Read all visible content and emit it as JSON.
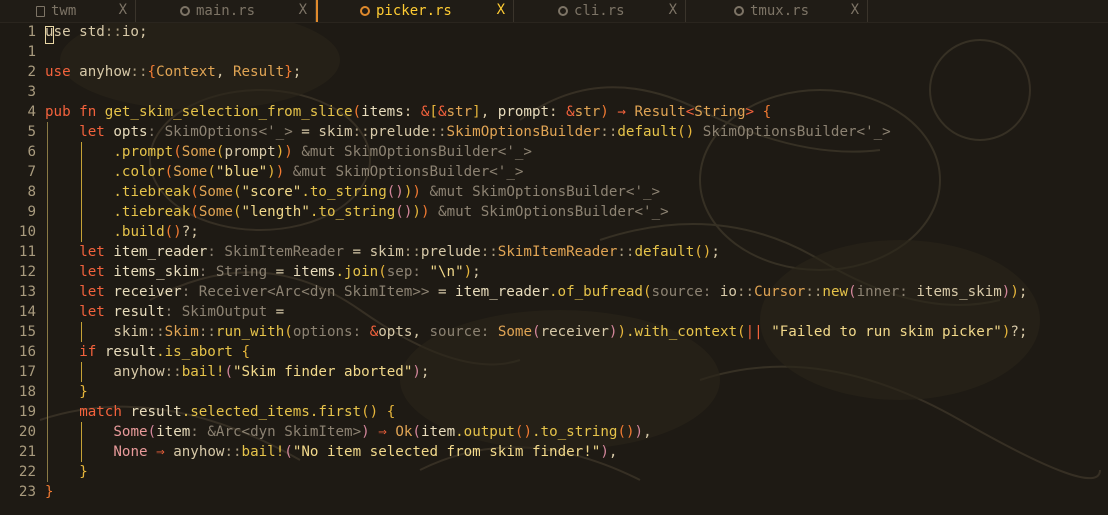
{
  "tabs": [
    {
      "label": "twm",
      "icon": "file-icon",
      "close": "X",
      "active": false
    },
    {
      "label": "main.rs",
      "icon": "rust-icon",
      "close": "X",
      "active": false
    },
    {
      "label": "picker.rs",
      "icon": "rust-icon",
      "close": "X",
      "active": true
    },
    {
      "label": "cli.rs",
      "icon": "rust-icon",
      "close": "X",
      "active": false
    },
    {
      "label": "tmux.rs",
      "icon": "rust-icon",
      "close": "X",
      "active": false
    }
  ],
  "colors": {
    "background": "#1e1a14",
    "keyword": "#f3623c",
    "function": "#e6c34a",
    "string": "#f2d98b",
    "inlay_hint": "#8c8272",
    "active_tab": "#ffcc33",
    "indent_guide": "#c6a236"
  },
  "lines": [
    {
      "num": "1",
      "indent": 0,
      "segs": [
        [
          "pl",
          "use std"
        ],
        [
          "op",
          "::"
        ],
        [
          "pl",
          "io;"
        ]
      ]
    },
    {
      "num": "1",
      "indent": 0,
      "segs": []
    },
    {
      "num": "2",
      "indent": 0,
      "segs": [
        [
          "kw",
          "use "
        ],
        [
          "pl",
          "anyhow"
        ],
        [
          "op",
          "::"
        ],
        [
          "br",
          "{"
        ],
        [
          "ty2",
          "Context"
        ],
        [
          "pl",
          ", "
        ],
        [
          "ty2",
          "Result"
        ],
        [
          "br",
          "}"
        ],
        [
          "pl",
          ";"
        ]
      ]
    },
    {
      "num": "3",
      "indent": 0,
      "segs": []
    },
    {
      "num": "4",
      "indent": 0,
      "segs": [
        [
          "kw",
          "pub fn "
        ],
        [
          "fn",
          "get_skim_selection_from_slice"
        ],
        [
          "br",
          "("
        ],
        [
          "var",
          "items"
        ],
        [
          "pl",
          ": "
        ],
        [
          "kw",
          "&"
        ],
        [
          "br2",
          "["
        ],
        [
          "kw",
          "&"
        ],
        [
          "ty2",
          "str"
        ],
        [
          "br2",
          "]"
        ],
        [
          "pl",
          ", "
        ],
        [
          "var",
          "prompt"
        ],
        [
          "pl",
          ": "
        ],
        [
          "kw",
          "&"
        ],
        [
          "ty2",
          "str"
        ],
        [
          "br",
          ")"
        ],
        [
          "pl",
          " "
        ],
        [
          "kw",
          "→"
        ],
        [
          "pl",
          " "
        ],
        [
          "ty2",
          "Result"
        ],
        [
          "kw",
          "<"
        ],
        [
          "ty2",
          "String"
        ],
        [
          "kw",
          "> "
        ],
        [
          "br",
          "{"
        ]
      ]
    },
    {
      "num": "5",
      "indent": 1,
      "segs": [
        [
          "kw",
          "let "
        ],
        [
          "var",
          "opts"
        ],
        [
          "hint",
          ": SkimOptions<'_>"
        ],
        [
          "pl",
          " = "
        ],
        [
          "pl",
          "skim"
        ],
        [
          "op",
          "::"
        ],
        [
          "pl",
          "prelude"
        ],
        [
          "op",
          "::"
        ],
        [
          "ty2",
          "SkimOptionsBuilder"
        ],
        [
          "op",
          "::"
        ],
        [
          "fn",
          "default"
        ],
        [
          "br2",
          "()"
        ],
        [
          "hint",
          " SkimOptionsBuilder<'_>"
        ]
      ]
    },
    {
      "num": "6",
      "indent": 2,
      "segs": [
        [
          "fn",
          ".prompt"
        ],
        [
          "br",
          "("
        ],
        [
          "ty2",
          "Some"
        ],
        [
          "br2",
          "("
        ],
        [
          "pl",
          "prompt"
        ],
        [
          "br2",
          ")"
        ],
        [
          "br",
          ")"
        ],
        [
          "hint",
          " &mut SkimOptionsBuilder<'_>"
        ]
      ]
    },
    {
      "num": "7",
      "indent": 2,
      "segs": [
        [
          "fn",
          ".color"
        ],
        [
          "br",
          "("
        ],
        [
          "ty2",
          "Some"
        ],
        [
          "br2",
          "("
        ],
        [
          "str",
          "\"blue\""
        ],
        [
          "br2",
          ")"
        ],
        [
          "br",
          ")"
        ],
        [
          "hint",
          " &mut SkimOptionsBuilder<'_>"
        ]
      ]
    },
    {
      "num": "8",
      "indent": 2,
      "segs": [
        [
          "fn",
          ".tiebreak"
        ],
        [
          "br",
          "("
        ],
        [
          "ty2",
          "Some"
        ],
        [
          "br2",
          "("
        ],
        [
          "str",
          "\"score\""
        ],
        [
          "fn",
          ".to_string"
        ],
        [
          "br3",
          "()"
        ],
        [
          "br2",
          ")"
        ],
        [
          "br",
          ")"
        ],
        [
          "hint",
          " &mut SkimOptionsBuilder<'_>"
        ]
      ]
    },
    {
      "num": "9",
      "indent": 2,
      "segs": [
        [
          "fn",
          ".tiebreak"
        ],
        [
          "br",
          "("
        ],
        [
          "ty2",
          "Some"
        ],
        [
          "br2",
          "("
        ],
        [
          "str",
          "\"length\""
        ],
        [
          "fn",
          ".to_string"
        ],
        [
          "br3",
          "()"
        ],
        [
          "br2",
          ")"
        ],
        [
          "br",
          ")"
        ],
        [
          "hint",
          " &mut SkimOptionsBuilder<'_>"
        ]
      ]
    },
    {
      "num": "10",
      "indent": 2,
      "segs": [
        [
          "fn",
          ".build"
        ],
        [
          "br",
          "()"
        ],
        [
          "pl",
          "?;"
        ]
      ]
    },
    {
      "num": "11",
      "indent": 1,
      "segs": [
        [
          "kw",
          "let "
        ],
        [
          "var",
          "item_reader"
        ],
        [
          "hint",
          ": SkimItemReader"
        ],
        [
          "pl",
          " = skim"
        ],
        [
          "op",
          "::"
        ],
        [
          "pl",
          "prelude"
        ],
        [
          "op",
          "::"
        ],
        [
          "ty2",
          "SkimItemReader"
        ],
        [
          "op",
          "::"
        ],
        [
          "fn",
          "default"
        ],
        [
          "br2",
          "()"
        ],
        [
          "pl",
          ";"
        ]
      ]
    },
    {
      "num": "12",
      "indent": 1,
      "segs": [
        [
          "kw",
          "let "
        ],
        [
          "var",
          "items_skim"
        ],
        [
          "hint",
          ": String"
        ],
        [
          "pl",
          " = "
        ],
        [
          "var",
          "items"
        ],
        [
          "fn",
          ".join"
        ],
        [
          "br2",
          "("
        ],
        [
          "hint",
          "sep: "
        ],
        [
          "str",
          "\"\\n\""
        ],
        [
          "br2",
          ")"
        ],
        [
          "pl",
          ";"
        ]
      ]
    },
    {
      "num": "13",
      "indent": 1,
      "segs": [
        [
          "kw",
          "let "
        ],
        [
          "var",
          "receiver"
        ],
        [
          "hint",
          ": Receiver<Arc<dyn SkimItem>>"
        ],
        [
          "pl",
          " = "
        ],
        [
          "var",
          "item_reader"
        ],
        [
          "fn",
          ".of_bufread"
        ],
        [
          "br2",
          "("
        ],
        [
          "hint",
          "source: "
        ],
        [
          "pl",
          "io"
        ],
        [
          "op",
          "::"
        ],
        [
          "ty2",
          "Cursor"
        ],
        [
          "op",
          "::"
        ],
        [
          "fn",
          "new"
        ],
        [
          "br3",
          "("
        ],
        [
          "hint",
          "inner: "
        ],
        [
          "pl",
          "items_skim"
        ],
        [
          "br3",
          ")"
        ],
        [
          "br2",
          ")"
        ],
        [
          "pl",
          ";"
        ]
      ]
    },
    {
      "num": "14",
      "indent": 1,
      "segs": [
        [
          "kw",
          "let "
        ],
        [
          "var",
          "result"
        ],
        [
          "hint",
          ": SkimOutput"
        ],
        [
          "pl",
          " ="
        ]
      ]
    },
    {
      "num": "15",
      "indent": 2,
      "segs": [
        [
          "pl",
          "skim"
        ],
        [
          "op",
          "::"
        ],
        [
          "ty2",
          "Skim"
        ],
        [
          "op",
          "::"
        ],
        [
          "fn",
          "run_with"
        ],
        [
          "br2",
          "("
        ],
        [
          "hint",
          "options: "
        ],
        [
          "kw",
          "&"
        ],
        [
          "pl",
          "opts"
        ],
        [
          "pl",
          ", "
        ],
        [
          "hint",
          "source: "
        ],
        [
          "ty2",
          "Some"
        ],
        [
          "br3",
          "("
        ],
        [
          "pl",
          "receiver"
        ],
        [
          "br3",
          ")"
        ],
        [
          "br2",
          ")"
        ],
        [
          "fn",
          ".with_context"
        ],
        [
          "br2",
          "("
        ],
        [
          "kw",
          "|| "
        ],
        [
          "str",
          "\"Failed to run skim picker\""
        ],
        [
          "br2",
          ")"
        ],
        [
          "pl",
          "?;"
        ]
      ]
    },
    {
      "num": "16",
      "indent": 1,
      "segs": [
        [
          "kw",
          "if "
        ],
        [
          "var",
          "result"
        ],
        [
          "fn",
          ".is_abort"
        ],
        [
          "pl",
          " "
        ],
        [
          "br2",
          "{"
        ]
      ]
    },
    {
      "num": "17",
      "indent": 2,
      "segs": [
        [
          "pl",
          "anyhow"
        ],
        [
          "op",
          "::"
        ],
        [
          "fn",
          "bail!"
        ],
        [
          "br3",
          "("
        ],
        [
          "str",
          "\"Skim finder aborted\""
        ],
        [
          "br3",
          ")"
        ],
        [
          "pl",
          ";"
        ]
      ]
    },
    {
      "num": "18",
      "indent": 1,
      "segs": [
        [
          "br2",
          "}"
        ]
      ]
    },
    {
      "num": "19",
      "indent": 1,
      "segs": [
        [
          "kw",
          "match "
        ],
        [
          "var",
          "result"
        ],
        [
          "fn",
          ".selected_items.first"
        ],
        [
          "br2",
          "()"
        ],
        [
          "pl",
          " "
        ],
        [
          "br2",
          "{"
        ]
      ]
    },
    {
      "num": "20",
      "indent": 2,
      "segs": [
        [
          "en",
          "Some"
        ],
        [
          "br3",
          "("
        ],
        [
          "var",
          "item"
        ],
        [
          "hint",
          ": &Arc<dyn SkimItem>"
        ],
        [
          "br3",
          ")"
        ],
        [
          "pl",
          " "
        ],
        [
          "kw",
          "⇒"
        ],
        [
          "pl",
          " "
        ],
        [
          "ty2",
          "Ok"
        ],
        [
          "br3",
          "("
        ],
        [
          "var",
          "item"
        ],
        [
          "fn",
          ".output"
        ],
        [
          "br",
          "()"
        ],
        [
          "fn",
          ".to_string"
        ],
        [
          "br",
          "()"
        ],
        [
          "br3",
          ")"
        ],
        [
          "pl",
          ","
        ]
      ]
    },
    {
      "num": "21",
      "indent": 2,
      "segs": [
        [
          "en",
          "None"
        ],
        [
          "pl",
          " "
        ],
        [
          "kw",
          "⇒"
        ],
        [
          "pl",
          " anyhow"
        ],
        [
          "op",
          "::"
        ],
        [
          "fn",
          "bail!"
        ],
        [
          "br3",
          "("
        ],
        [
          "str",
          "\"No item selected from skim finder!\""
        ],
        [
          "br3",
          ")"
        ],
        [
          "pl",
          ","
        ]
      ]
    },
    {
      "num": "22",
      "indent": 1,
      "segs": [
        [
          "br2",
          "}"
        ]
      ]
    },
    {
      "num": "23",
      "indent": 0,
      "segs": [
        [
          "br",
          "}"
        ]
      ]
    }
  ]
}
